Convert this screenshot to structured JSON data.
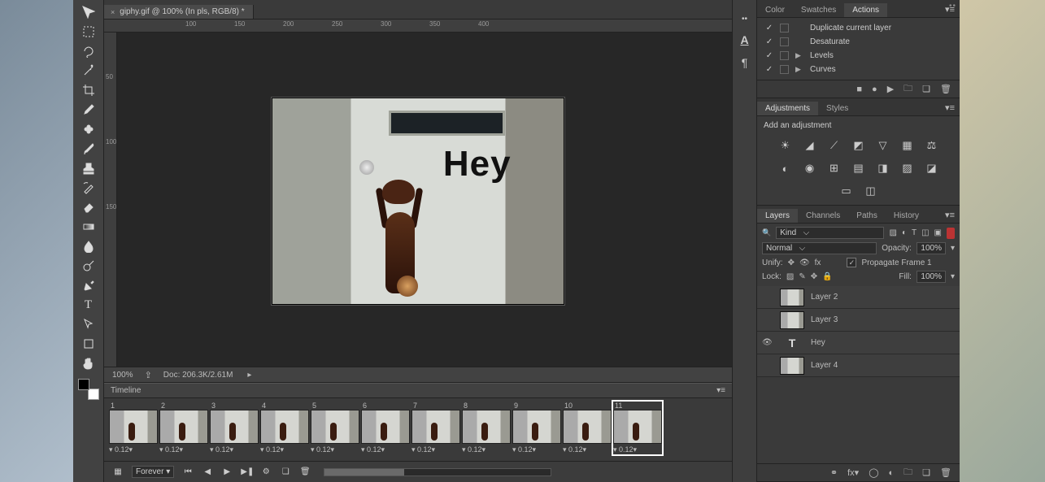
{
  "document": {
    "tab_title": "giphy.gif @ 100% (In pls, RGB/8) *",
    "zoom": "100%",
    "doc_info": "Doc: 206.3K/2.61M",
    "canvas_text": "Hey"
  },
  "ruler_h": [
    "100",
    "150",
    "200",
    "250",
    "300",
    "350",
    "400"
  ],
  "ruler_v": [
    "50",
    "100",
    "150"
  ],
  "timeline": {
    "title": "Timeline",
    "frames": [
      {
        "n": "1",
        "d": "0.12▾"
      },
      {
        "n": "2",
        "d": "0.12▾"
      },
      {
        "n": "3",
        "d": "0.12▾"
      },
      {
        "n": "4",
        "d": "0.12▾"
      },
      {
        "n": "5",
        "d": "0.12▾"
      },
      {
        "n": "6",
        "d": "0.12▾"
      },
      {
        "n": "7",
        "d": "0.12▾"
      },
      {
        "n": "8",
        "d": "0.12▾"
      },
      {
        "n": "9",
        "d": "0.12▾"
      },
      {
        "n": "10",
        "d": "0.12▾"
      },
      {
        "n": "11",
        "d": "0.12▾"
      }
    ],
    "loop": "Forever"
  },
  "actions_panel": {
    "tabs": [
      "Color",
      "Swatches",
      "Actions"
    ],
    "active": 2,
    "items": [
      {
        "check": "✓",
        "expand": "",
        "label": "Duplicate current layer"
      },
      {
        "check": "✓",
        "expand": "",
        "label": "Desaturate"
      },
      {
        "check": "✓",
        "expand": "▶",
        "label": "Levels"
      },
      {
        "check": "✓",
        "expand": "▶",
        "label": "Curves"
      }
    ]
  },
  "adjustments_panel": {
    "tabs": [
      "Adjustments",
      "Styles"
    ],
    "active": 0,
    "heading": "Add an adjustment"
  },
  "layers_panel": {
    "tabs": [
      "Layers",
      "Channels",
      "Paths",
      "History"
    ],
    "active": 0,
    "kind_label": "Kind",
    "blend": "Normal",
    "opacity_label": "Opacity:",
    "opacity_val": "100%",
    "unify_label": "Unify:",
    "propagate": "Propagate Frame 1",
    "lock_label": "Lock:",
    "fill_label": "Fill:",
    "fill_val": "100%",
    "layers": [
      {
        "vis": "",
        "type": "img",
        "name": "Layer 2"
      },
      {
        "vis": "",
        "type": "img",
        "name": "Layer 3"
      },
      {
        "vis": "👁",
        "type": "T",
        "name": "Hey"
      },
      {
        "vis": "",
        "type": "img",
        "name": "Layer 4"
      }
    ]
  }
}
